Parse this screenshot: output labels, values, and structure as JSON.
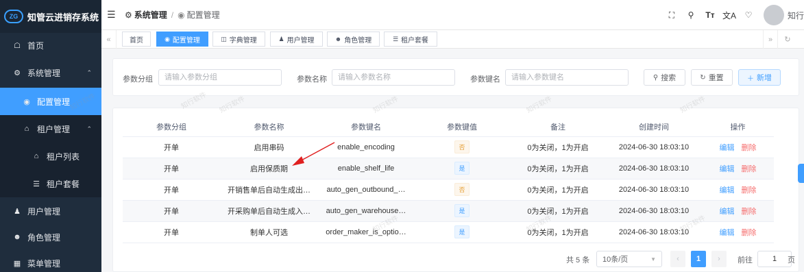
{
  "app": {
    "title": "知管云进销存系统",
    "logo_text": "ZG"
  },
  "sidebar": {
    "items": [
      {
        "label": "首页",
        "icon": "home-icon"
      },
      {
        "label": "系统管理",
        "icon": "gear-icon"
      },
      {
        "label": "配置管理",
        "icon": "config-icon"
      },
      {
        "label": "租户管理",
        "icon": "tenant-icon"
      },
      {
        "label": "租户列表",
        "icon": "house-icon"
      },
      {
        "label": "租户套餐",
        "icon": "list-icon"
      },
      {
        "label": "用户管理",
        "icon": "user-icon"
      },
      {
        "label": "角色管理",
        "icon": "role-icon"
      },
      {
        "label": "菜单管理",
        "icon": "menu-grid-icon"
      }
    ]
  },
  "header": {
    "breadcrumb": [
      "系统管理",
      "配置管理"
    ],
    "user_name": "知行"
  },
  "tags": [
    {
      "label": "首页",
      "active": false
    },
    {
      "label": "配置管理",
      "active": true
    },
    {
      "label": "字典管理",
      "active": false
    },
    {
      "label": "用户管理",
      "active": false
    },
    {
      "label": "角色管理",
      "active": false
    },
    {
      "label": "租户套餐",
      "active": false
    }
  ],
  "search": {
    "group_label": "参数分组",
    "group_placeholder": "请输入参数分组",
    "name_label": "参数名称",
    "name_placeholder": "请输入参数名称",
    "key_label": "参数键名",
    "key_placeholder": "请输入参数键名",
    "search_button": "搜索",
    "reset_button": "重置",
    "add_button": "新增"
  },
  "table": {
    "columns": [
      "参数分组",
      "参数名称",
      "参数键名",
      "参数键值",
      "备注",
      "创建时间",
      "操作"
    ],
    "rows": [
      {
        "group": "开单",
        "name": "启用串码",
        "key": "enable_encoding",
        "value": "否",
        "remark": "0为关闭，1为开启",
        "created": "2024-06-30 18:03:10"
      },
      {
        "group": "开单",
        "name": "启用保质期",
        "key": "enable_shelf_life",
        "value": "是",
        "remark": "0为关闭，1为开启",
        "created": "2024-06-30 18:03:10"
      },
      {
        "group": "开单",
        "name": "开销售单后自动生成出…",
        "key": "auto_gen_outbound_…",
        "value": "否",
        "remark": "0为关闭，1为开启",
        "created": "2024-06-30 18:03:10"
      },
      {
        "group": "开单",
        "name": "开采购单后自动生成入…",
        "key": "auto_gen_warehouse…",
        "value": "是",
        "remark": "0为关闭，1为开启",
        "created": "2024-06-30 18:03:10"
      },
      {
        "group": "开单",
        "name": "制单人可选",
        "key": "order_maker_is_optio…",
        "value": "是",
        "remark": "0为关闭，1为开启",
        "created": "2024-06-30 18:03:10"
      }
    ],
    "edit_label": "编辑",
    "delete_label": "删除"
  },
  "pagination": {
    "total": "共 5 条",
    "page_size": "10条/页",
    "current_page": "1",
    "goto_label": "前往",
    "goto_value": "1",
    "page_suffix": "页"
  },
  "watermark": "知行软件",
  "colors": {
    "accent": "#409eff",
    "sidebar": "#1f2d3d",
    "danger": "#f56c6c",
    "warning": "#e6a23c"
  }
}
